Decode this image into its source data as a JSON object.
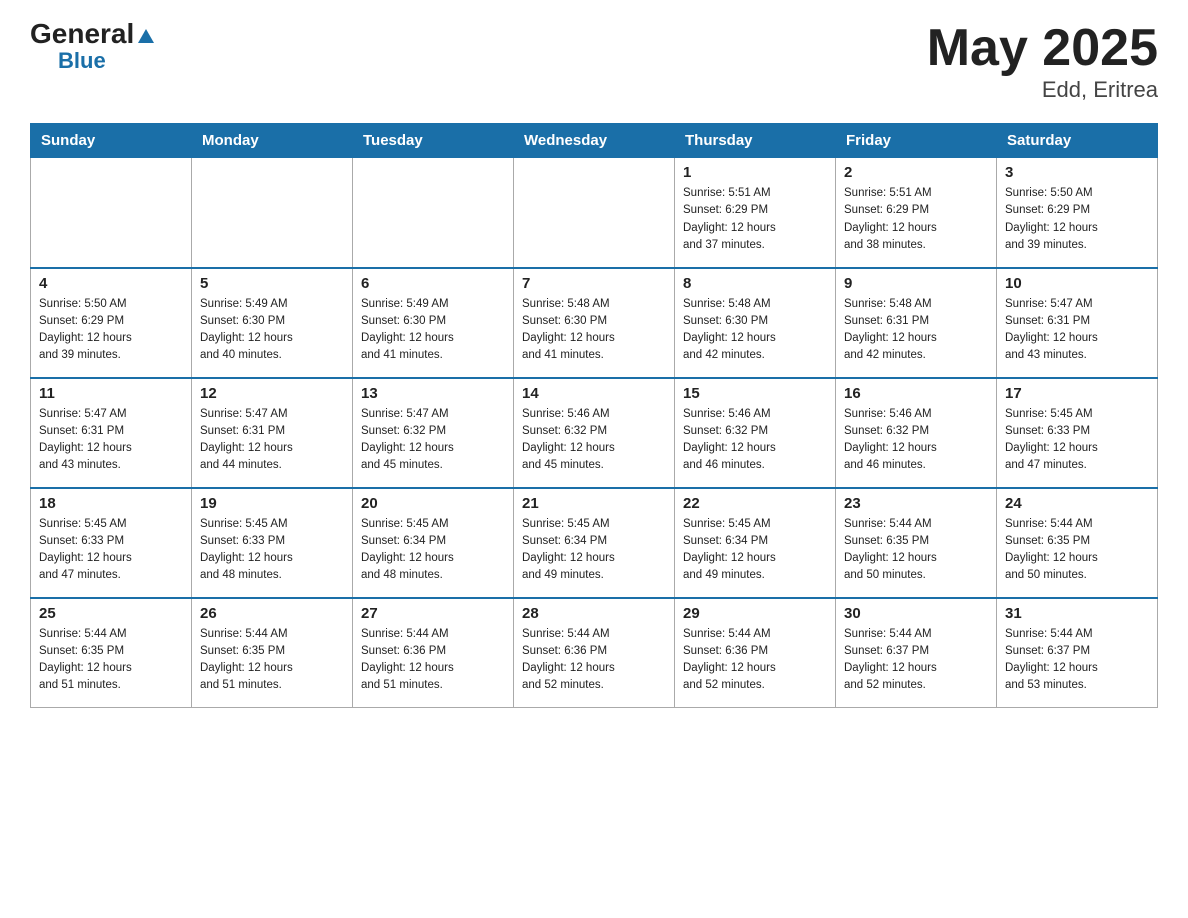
{
  "header": {
    "logo_general": "General",
    "logo_triangle": "",
    "logo_blue": "Blue",
    "title": "May 2025",
    "subtitle": "Edd, Eritrea"
  },
  "calendar": {
    "days_of_week": [
      "Sunday",
      "Monday",
      "Tuesday",
      "Wednesday",
      "Thursday",
      "Friday",
      "Saturday"
    ],
    "weeks": [
      [
        {
          "day": "",
          "info": ""
        },
        {
          "day": "",
          "info": ""
        },
        {
          "day": "",
          "info": ""
        },
        {
          "day": "",
          "info": ""
        },
        {
          "day": "1",
          "info": "Sunrise: 5:51 AM\nSunset: 6:29 PM\nDaylight: 12 hours\nand 37 minutes."
        },
        {
          "day": "2",
          "info": "Sunrise: 5:51 AM\nSunset: 6:29 PM\nDaylight: 12 hours\nand 38 minutes."
        },
        {
          "day": "3",
          "info": "Sunrise: 5:50 AM\nSunset: 6:29 PM\nDaylight: 12 hours\nand 39 minutes."
        }
      ],
      [
        {
          "day": "4",
          "info": "Sunrise: 5:50 AM\nSunset: 6:29 PM\nDaylight: 12 hours\nand 39 minutes."
        },
        {
          "day": "5",
          "info": "Sunrise: 5:49 AM\nSunset: 6:30 PM\nDaylight: 12 hours\nand 40 minutes."
        },
        {
          "day": "6",
          "info": "Sunrise: 5:49 AM\nSunset: 6:30 PM\nDaylight: 12 hours\nand 41 minutes."
        },
        {
          "day": "7",
          "info": "Sunrise: 5:48 AM\nSunset: 6:30 PM\nDaylight: 12 hours\nand 41 minutes."
        },
        {
          "day": "8",
          "info": "Sunrise: 5:48 AM\nSunset: 6:30 PM\nDaylight: 12 hours\nand 42 minutes."
        },
        {
          "day": "9",
          "info": "Sunrise: 5:48 AM\nSunset: 6:31 PM\nDaylight: 12 hours\nand 42 minutes."
        },
        {
          "day": "10",
          "info": "Sunrise: 5:47 AM\nSunset: 6:31 PM\nDaylight: 12 hours\nand 43 minutes."
        }
      ],
      [
        {
          "day": "11",
          "info": "Sunrise: 5:47 AM\nSunset: 6:31 PM\nDaylight: 12 hours\nand 43 minutes."
        },
        {
          "day": "12",
          "info": "Sunrise: 5:47 AM\nSunset: 6:31 PM\nDaylight: 12 hours\nand 44 minutes."
        },
        {
          "day": "13",
          "info": "Sunrise: 5:47 AM\nSunset: 6:32 PM\nDaylight: 12 hours\nand 45 minutes."
        },
        {
          "day": "14",
          "info": "Sunrise: 5:46 AM\nSunset: 6:32 PM\nDaylight: 12 hours\nand 45 minutes."
        },
        {
          "day": "15",
          "info": "Sunrise: 5:46 AM\nSunset: 6:32 PM\nDaylight: 12 hours\nand 46 minutes."
        },
        {
          "day": "16",
          "info": "Sunrise: 5:46 AM\nSunset: 6:32 PM\nDaylight: 12 hours\nand 46 minutes."
        },
        {
          "day": "17",
          "info": "Sunrise: 5:45 AM\nSunset: 6:33 PM\nDaylight: 12 hours\nand 47 minutes."
        }
      ],
      [
        {
          "day": "18",
          "info": "Sunrise: 5:45 AM\nSunset: 6:33 PM\nDaylight: 12 hours\nand 47 minutes."
        },
        {
          "day": "19",
          "info": "Sunrise: 5:45 AM\nSunset: 6:33 PM\nDaylight: 12 hours\nand 48 minutes."
        },
        {
          "day": "20",
          "info": "Sunrise: 5:45 AM\nSunset: 6:34 PM\nDaylight: 12 hours\nand 48 minutes."
        },
        {
          "day": "21",
          "info": "Sunrise: 5:45 AM\nSunset: 6:34 PM\nDaylight: 12 hours\nand 49 minutes."
        },
        {
          "day": "22",
          "info": "Sunrise: 5:45 AM\nSunset: 6:34 PM\nDaylight: 12 hours\nand 49 minutes."
        },
        {
          "day": "23",
          "info": "Sunrise: 5:44 AM\nSunset: 6:35 PM\nDaylight: 12 hours\nand 50 minutes."
        },
        {
          "day": "24",
          "info": "Sunrise: 5:44 AM\nSunset: 6:35 PM\nDaylight: 12 hours\nand 50 minutes."
        }
      ],
      [
        {
          "day": "25",
          "info": "Sunrise: 5:44 AM\nSunset: 6:35 PM\nDaylight: 12 hours\nand 51 minutes."
        },
        {
          "day": "26",
          "info": "Sunrise: 5:44 AM\nSunset: 6:35 PM\nDaylight: 12 hours\nand 51 minutes."
        },
        {
          "day": "27",
          "info": "Sunrise: 5:44 AM\nSunset: 6:36 PM\nDaylight: 12 hours\nand 51 minutes."
        },
        {
          "day": "28",
          "info": "Sunrise: 5:44 AM\nSunset: 6:36 PM\nDaylight: 12 hours\nand 52 minutes."
        },
        {
          "day": "29",
          "info": "Sunrise: 5:44 AM\nSunset: 6:36 PM\nDaylight: 12 hours\nand 52 minutes."
        },
        {
          "day": "30",
          "info": "Sunrise: 5:44 AM\nSunset: 6:37 PM\nDaylight: 12 hours\nand 52 minutes."
        },
        {
          "day": "31",
          "info": "Sunrise: 5:44 AM\nSunset: 6:37 PM\nDaylight: 12 hours\nand 53 minutes."
        }
      ]
    ]
  }
}
